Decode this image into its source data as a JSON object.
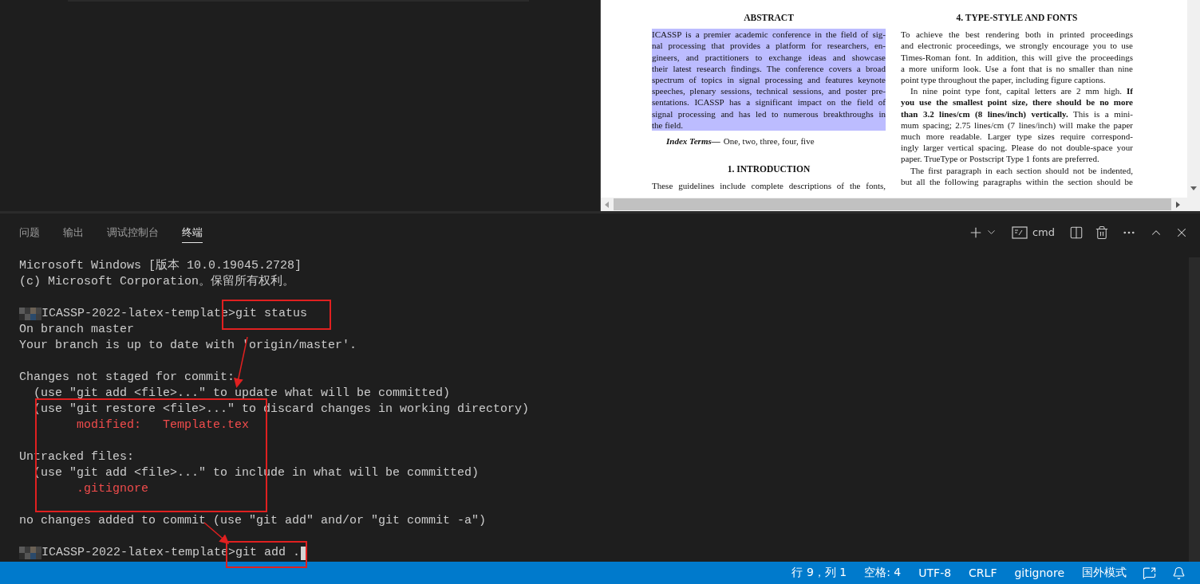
{
  "pdf": {
    "columns": [
      {
        "blocks": [
          {
            "kind": "heading",
            "text": "ABSTRACT"
          },
          {
            "kind": "paragraph",
            "selected": true,
            "indent": false,
            "cut": false,
            "lines": [
              "ICASSP is a premier academic conference in the field of sig-",
              "nal processing that provides a platform for researchers, en-",
              "gineers, and practitioners to exchange ideas and showcase",
              "their latest research findings. The conference covers a broad",
              "spectrum of topics in signal processing and features keynote",
              "speeches, plenary sessions, technical sessions, and poster pre-",
              "sentations. ICASSP has a significant impact on the field of",
              "signal processing and has led to numerous breakthroughs in",
              "the field."
            ]
          },
          {
            "kind": "index_terms",
            "label": "Index Terms—",
            "text": "One, two, three, four, five"
          },
          {
            "kind": "heading",
            "text": "1.  INTRODUCTION"
          },
          {
            "kind": "paragraph",
            "selected": false,
            "indent": false,
            "cut": true,
            "lines": [
              "These guidelines include complete descriptions of the fonts,"
            ]
          }
        ]
      },
      {
        "blocks": [
          {
            "kind": "heading",
            "text": "4.  TYPE-STYLE AND FONTS"
          },
          {
            "kind": "paragraph",
            "selected": false,
            "indent": false,
            "cut": false,
            "lines": [
              "To achieve the best rendering both in printed proceedings",
              "and electronic proceedings, we strongly encourage you to use",
              "Times-Roman font. In addition, this will give the proceedings",
              "a more uniform look. Use a font that is no smaller than nine",
              "point type throughout the paper, including figure captions."
            ]
          },
          {
            "kind": "paragraph",
            "selected": false,
            "indent": true,
            "cut": false,
            "lines": [
              "In nine point type font, capital letters are 2 mm high. **If**",
              "**you use the smallest point size, there should be no more**",
              "**than 3.2 lines/cm (8 lines/inch) vertically.** This is a mini-",
              "mum spacing; 2.75 lines/cm (7 lines/inch) will make the paper",
              "much more readable. Larger type sizes require correspond-",
              "ingly larger vertical spacing. Please do not double-space your",
              "paper. TrueType or Postscript Type 1 fonts are preferred."
            ]
          },
          {
            "kind": "paragraph",
            "selected": false,
            "indent": true,
            "cut": true,
            "lines": [
              "The first paragraph in each section should not be indented,",
              "but all the following paragraphs within the section should be"
            ]
          }
        ]
      }
    ]
  },
  "panel": {
    "tabs": [
      {
        "label": "问题",
        "selected": false
      },
      {
        "label": "输出",
        "selected": false
      },
      {
        "label": "调试控制台",
        "selected": false
      },
      {
        "label": "终端",
        "selected": true
      }
    ],
    "shell": "cmd"
  },
  "terminal": {
    "lines": [
      {
        "kind": "output",
        "text": "Microsoft Windows [版本 10.0.19045.2728]"
      },
      {
        "kind": "output",
        "text": "(c) Microsoft Corporation。保留所有权利。"
      },
      {
        "kind": "blank"
      },
      {
        "kind": "prompt",
        "path": "ICASSP-2022-latex-template>",
        "command": "git status",
        "cursor": false
      },
      {
        "kind": "output",
        "text": "On branch master"
      },
      {
        "kind": "output",
        "text": "Your branch is up to date with 'origin/master'."
      },
      {
        "kind": "blank"
      },
      {
        "kind": "output",
        "text": "Changes not staged for commit:"
      },
      {
        "kind": "output",
        "text": "  (use \"git add <file>...\" to update what will be committed)"
      },
      {
        "kind": "output",
        "text": "  (use \"git restore <file>...\" to discard changes in working directory)"
      },
      {
        "kind": "error",
        "text": "        modified:   Template.tex"
      },
      {
        "kind": "blank"
      },
      {
        "kind": "output",
        "text": "Untracked files:"
      },
      {
        "kind": "output",
        "text": "  (use \"git add <file>...\" to include in what will be committed)"
      },
      {
        "kind": "error",
        "text": "        .gitignore"
      },
      {
        "kind": "blank"
      },
      {
        "kind": "output",
        "text": "no changes added to commit (use \"git add\" and/or \"git commit -a\")"
      },
      {
        "kind": "blank"
      },
      {
        "kind": "prompt",
        "path": "ICASSP-2022-latex-template>",
        "command": "git add .",
        "cursor": true
      }
    ]
  },
  "status_bar": {
    "items": [
      "行 9，列 1",
      "空格: 4",
      "UTF-8",
      "CRLF",
      "gitignore",
      "国外模式"
    ]
  }
}
